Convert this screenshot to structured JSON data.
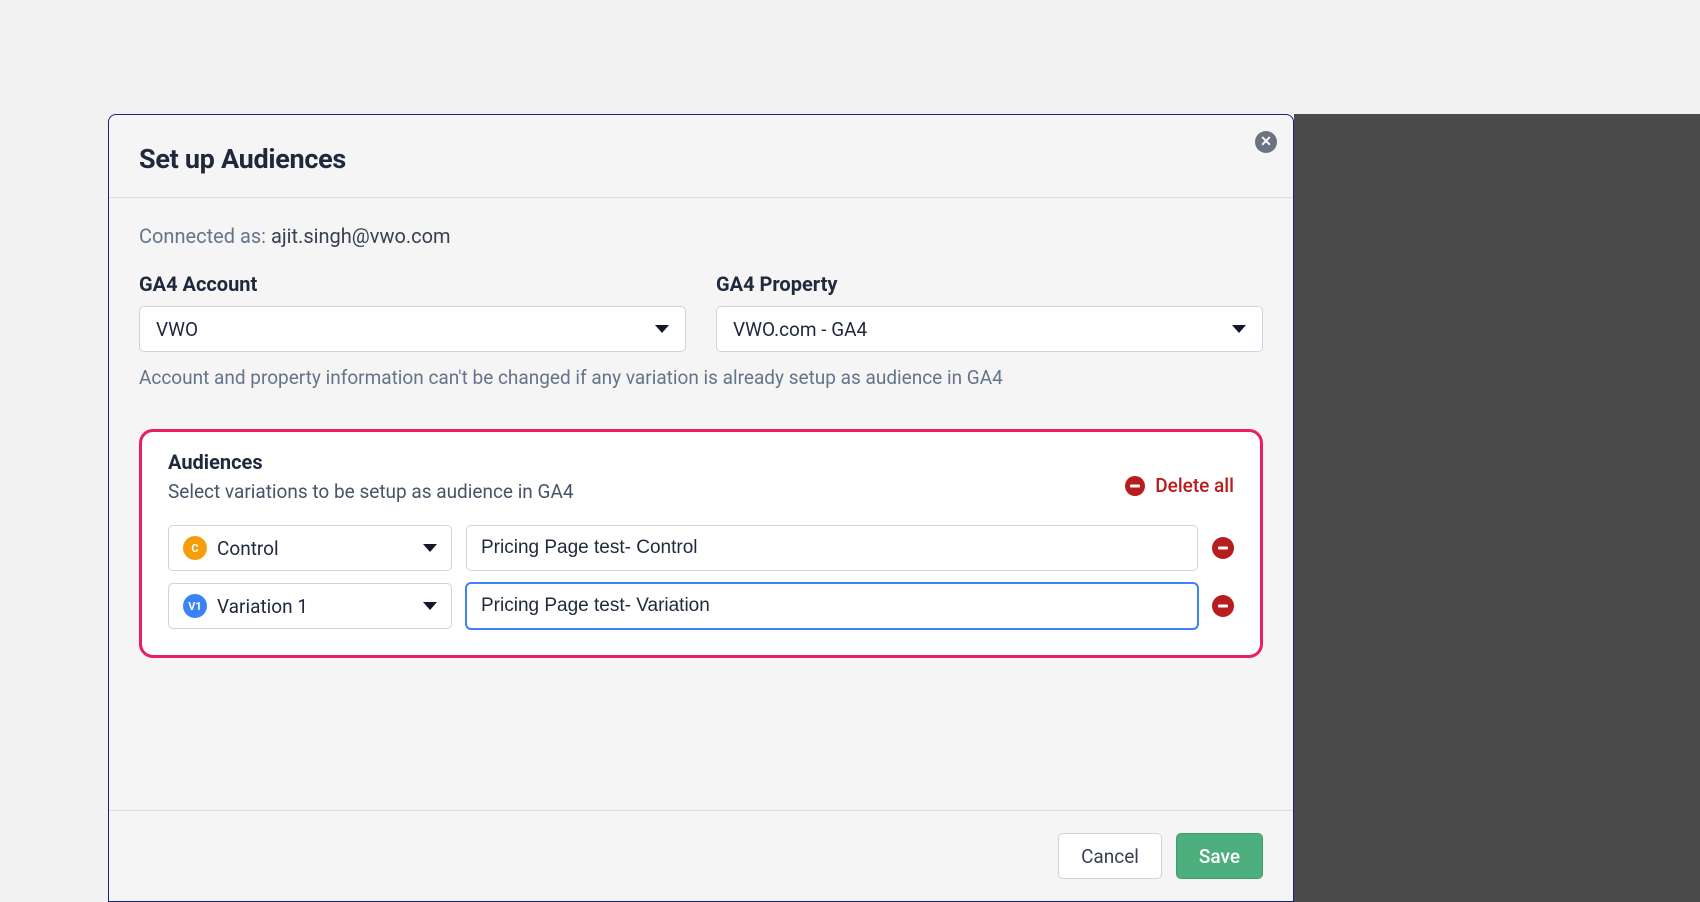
{
  "modal": {
    "title": "Set up Audiences",
    "connected_label": "Connected as: ",
    "connected_email": "ajit.singh@vwo.com",
    "fields": {
      "account": {
        "label": "GA4 Account",
        "value": "VWO"
      },
      "property": {
        "label": "GA4 Property",
        "value": "VWO.com - GA4"
      }
    },
    "hint": "Account and property information can't be changed if any variation is already setup as audience in GA4",
    "audiences": {
      "title": "Audiences",
      "subtitle": "Select variations to be setup as audience in GA4",
      "delete_all_label": "Delete all",
      "rows": [
        {
          "badge": "C",
          "badge_class": "badge-c",
          "variation": "Control",
          "name": "Pricing Page test- Control",
          "active": false
        },
        {
          "badge": "V1",
          "badge_class": "badge-v1",
          "variation": "Variation 1",
          "name": "Pricing Page test- Variation",
          "active": true
        }
      ]
    },
    "footer": {
      "cancel": "Cancel",
      "save": "Save"
    }
  }
}
